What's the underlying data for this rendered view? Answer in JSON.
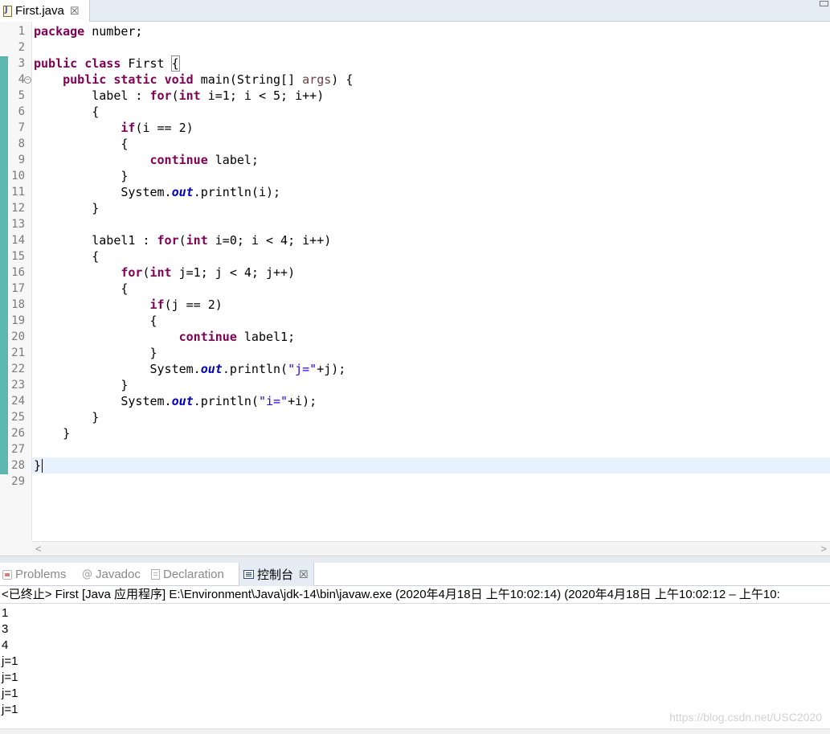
{
  "editor_tab": {
    "title": "First.java",
    "close": "☒"
  },
  "code": {
    "line_numbers": [
      "1",
      "2",
      "3",
      "4",
      "5",
      "6",
      "7",
      "8",
      "9",
      "10",
      "11",
      "12",
      "13",
      "14",
      "15",
      "16",
      "17",
      "18",
      "19",
      "20",
      "21",
      "22",
      "23",
      "24",
      "25",
      "26",
      "27",
      "28",
      "29"
    ],
    "fold_marker": "−",
    "lines": [
      [
        {
          "t": "package",
          "c": "kw"
        },
        {
          "t": " number;"
        }
      ],
      [],
      [
        {
          "t": "public",
          "c": "kw"
        },
        {
          "t": " "
        },
        {
          "t": "class",
          "c": "kw"
        },
        {
          "t": " First "
        },
        {
          "t": "{",
          "c": "brace-hl"
        }
      ],
      [
        {
          "t": "    "
        },
        {
          "t": "public",
          "c": "kw"
        },
        {
          "t": " "
        },
        {
          "t": "static",
          "c": "kw"
        },
        {
          "t": " "
        },
        {
          "t": "void",
          "c": "kw"
        },
        {
          "t": " main(String[] "
        },
        {
          "t": "args",
          "c": "param"
        },
        {
          "t": ") {"
        }
      ],
      [
        {
          "t": "        label : "
        },
        {
          "t": "for",
          "c": "kw"
        },
        {
          "t": "("
        },
        {
          "t": "int",
          "c": "kw"
        },
        {
          "t": " i=1; i < 5; i++)"
        }
      ],
      [
        {
          "t": "        {"
        }
      ],
      [
        {
          "t": "            "
        },
        {
          "t": "if",
          "c": "kw"
        },
        {
          "t": "(i == 2)"
        }
      ],
      [
        {
          "t": "            {"
        }
      ],
      [
        {
          "t": "                "
        },
        {
          "t": "continue",
          "c": "kw"
        },
        {
          "t": " label;"
        }
      ],
      [
        {
          "t": "            }"
        }
      ],
      [
        {
          "t": "            System."
        },
        {
          "t": "out",
          "c": "st"
        },
        {
          "t": ".println(i);"
        }
      ],
      [
        {
          "t": "        }"
        }
      ],
      [],
      [
        {
          "t": "        label1 : "
        },
        {
          "t": "for",
          "c": "kw"
        },
        {
          "t": "("
        },
        {
          "t": "int",
          "c": "kw"
        },
        {
          "t": " i=0; i < 4; i++)"
        }
      ],
      [
        {
          "t": "        {"
        }
      ],
      [
        {
          "t": "            "
        },
        {
          "t": "for",
          "c": "kw"
        },
        {
          "t": "("
        },
        {
          "t": "int",
          "c": "kw"
        },
        {
          "t": " j=1; j < 4; j++)"
        }
      ],
      [
        {
          "t": "            {"
        }
      ],
      [
        {
          "t": "                "
        },
        {
          "t": "if",
          "c": "kw"
        },
        {
          "t": "(j == 2)"
        }
      ],
      [
        {
          "t": "                {"
        }
      ],
      [
        {
          "t": "                    "
        },
        {
          "t": "continue",
          "c": "kw"
        },
        {
          "t": " label1;"
        }
      ],
      [
        {
          "t": "                }"
        }
      ],
      [
        {
          "t": "                System."
        },
        {
          "t": "out",
          "c": "st"
        },
        {
          "t": ".println("
        },
        {
          "t": "\"j=\"",
          "c": "str"
        },
        {
          "t": "+j);"
        }
      ],
      [
        {
          "t": "            }"
        }
      ],
      [
        {
          "t": "            System."
        },
        {
          "t": "out",
          "c": "st"
        },
        {
          "t": ".println("
        },
        {
          "t": "\"i=\"",
          "c": "str"
        },
        {
          "t": "+i);"
        }
      ],
      [
        {
          "t": "        }"
        }
      ],
      [
        {
          "t": "    }"
        }
      ],
      [],
      [
        {
          "t": "}"
        }
      ],
      []
    ]
  },
  "scroll": {
    "left": "<",
    "right": ">"
  },
  "view_tabs": {
    "problems": "Problems",
    "javadoc": "Javadoc",
    "javadoc_icon": "@",
    "declaration": "Declaration",
    "console": "控制台",
    "console_close": "☒"
  },
  "console": {
    "status": "<已终止> First [Java 应用程序] E:\\Environment\\Java\\jdk-14\\bin\\javaw.exe  (2020年4月18日 上午10:02:14)   (2020年4月18日 上午10:02:12 – 上午10:",
    "output": [
      "1",
      "3",
      "4",
      "j=1",
      "j=1",
      "j=1",
      "j=1"
    ]
  },
  "watermark": "https://blog.csdn.net/USC2020",
  "icons": [
    "java-file-icon",
    "close-icon",
    "maximize-icon",
    "fold-icon",
    "problems-icon",
    "javadoc-icon",
    "declaration-icon",
    "console-icon"
  ],
  "colors": {
    "keyword": "#7f0055",
    "static_field": "#0000c0",
    "string": "#2a00ff",
    "parameter": "#6a3e3e",
    "change_bar": "#5cb7b1",
    "current_line": "#e8f2fe"
  }
}
